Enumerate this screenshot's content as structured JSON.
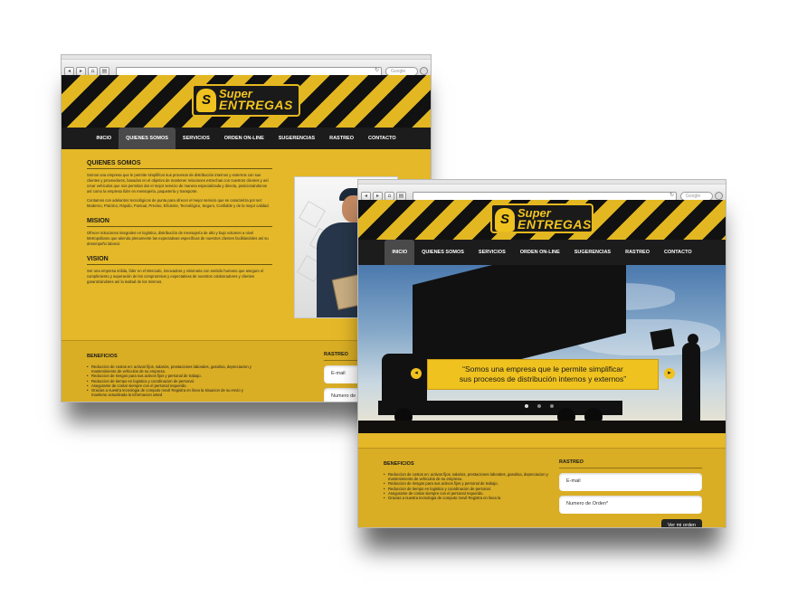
{
  "brand": {
    "line1": "Super",
    "line2": "ENTREGAS"
  },
  "browser": {
    "search_placeholder": "Google"
  },
  "nav": [
    {
      "label": "INICIO"
    },
    {
      "label": "QUIENES SOMOS"
    },
    {
      "label": "SERVICIOS"
    },
    {
      "label": "ORDEN ON-LINE"
    },
    {
      "label": "SUGERENCIAS"
    },
    {
      "label": "RASTREO"
    },
    {
      "label": "CONTACTO"
    }
  ],
  "about": {
    "quienes_title": "QUIENES SOMOS",
    "quienes_p1": "Somos una empresa que le permite simplificar sus procesos de distribución internos y externos con sus clientes y proveedores, basados en el objetivo de mantener relaciones estrechas con nuestros clientes y así crear vehículos que nos permitan dar el mejor servicio de manera especializada y directa, posicionándonos así como la empresa líder en mensajería, paquetería y transporte.",
    "quienes_p2": "Contamos con adelantos tecnológicos de punta para ofrecer el mejor servicio que se caracteriza por ser: Moderno, Práctico, Rápido, Puntual, Preciso, Eficiente, Tecnológico, Seguro, Confiable y de la mejor calidad.",
    "mision_title": "MISION",
    "mision_text": "Ofrecer soluciones integrales en logística, distribución de mensajería de alto y bajo volumen a nivel Metropolitano que atienda plenamente las expectativas específicas de nuestros clientes facilitándoles así su desempeño laboral.",
    "vision_title": "VISION",
    "vision_text": "Ser una empresa sólida, líder en el Mercado, innovadora y visionaria con sentido humano que asegure el cumplimiento y superación de los compromisos y expectativas de nuestros colaboradores y clientes garantizándoles así la lealtad de los mismos."
  },
  "hero": {
    "quote_line1": "“Somos una empresa que le permite simplificar",
    "quote_line2": "sus procesos de distribución internos y externos”",
    "prev_glyph": "◂",
    "next_glyph": "▸"
  },
  "benefits": {
    "title": "BENEFICIOS",
    "items": [
      "Reduccion de costos en: activos fijos, salarios, prestaciones laborales, gasolina, depreciacion y mantenimiento de vehiculos de su empresa.",
      "Reduccion de riesgos para sus activos fijos y personal de trabajo.",
      "Reduccion de tiempo en logistica y coordinacion de personal.",
      "Asegurarse de contar siempre con el personal requerido.",
      "Gracias a nuestra tecnologia de computo movil Registra en linea  la situacion de su envio y mantiene actualizada la informacion usted"
    ],
    "items_front": [
      "Reduccion de costos en: activos fijos, salarios, prestaciones laborales, gasolina, depreciacion y mantenimiento de vehiculos de su empresa.",
      "Reduccion de riesgos para sus activos fijos y personal de trabajo.",
      "Reduccion de tiempo en logistica y coordinacion de personal.",
      "Asegurarse de contar siempre con el personal requerido.",
      "Gracias a nuestra tecnologia de computo movil Registra en linea  la"
    ]
  },
  "rastreo": {
    "title": "RASTREO",
    "email": "E-mail",
    "orden": "Numero de Orden*",
    "button": "Ver mi orden"
  }
}
